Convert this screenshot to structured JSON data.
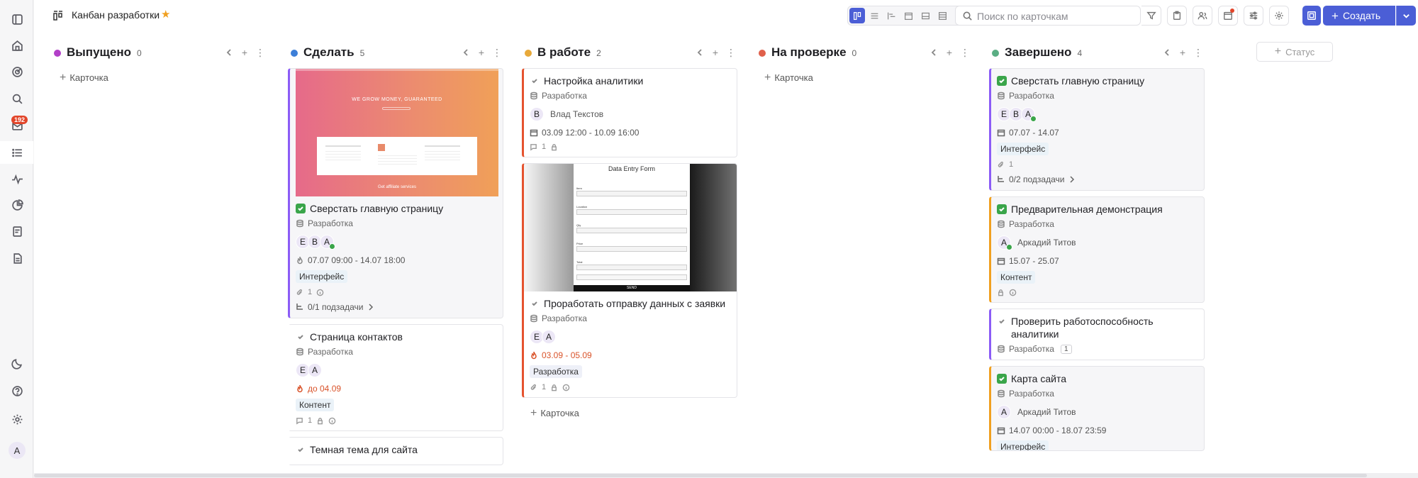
{
  "header": {
    "title": "Канбан разработки",
    "search_placeholder": "Поиск по карточкам",
    "create_label": "Создать"
  },
  "rail": {
    "inbox_badge": "192",
    "avatar": "А"
  },
  "colors": {
    "accent": "#4b5ed6",
    "done_check": "#3aa54a",
    "overdue": "#d9532a"
  },
  "columns": [
    {
      "title": "Выпущено",
      "count": "0",
      "color": "#b23fc8",
      "add_label": "Карточка"
    },
    {
      "title": "Сделать",
      "count": "5",
      "color": "#3d7fd8",
      "add_label": "Карточка"
    },
    {
      "title": "В работе",
      "count": "2",
      "color": "#e8a93a",
      "add_label": "Карточка"
    },
    {
      "title": "На проверке",
      "count": "0",
      "color": "#e0604b",
      "add_label": "Карточка"
    },
    {
      "title": "Завершено",
      "count": "4",
      "color": "#5aae84",
      "add_label": "Карточка"
    }
  ],
  "status_add_label": "Статус",
  "cards": {
    "todo1": {
      "title": "Сверстать главную страницу",
      "project": "Разработка",
      "avatars": [
        "Е",
        "В",
        "А"
      ],
      "date": "07.07 09:00 - 14.07 18:00",
      "tag": "Интерфейс",
      "attach": "1",
      "subtasks": "0/1 подзадачи",
      "image": {
        "headline": "WE GROW MONEY, GUARANTEED",
        "footer": "Get affiliate services"
      }
    },
    "todo2": {
      "title": "Страница контактов",
      "project": "Разработка",
      "avatars": [
        "Е",
        "А"
      ],
      "date": "до 04.09",
      "tag": "Контент",
      "comments": "1"
    },
    "todo3": {
      "title": "Темная тема для сайта"
    },
    "work1": {
      "title": "Настройка аналитики",
      "project": "Разработка",
      "avatar": "В",
      "person": "Влад Текстов",
      "date": "03.09 12:00 - 10.09 16:00",
      "comments": "1"
    },
    "work2": {
      "title": "Проработать отправку данных с заявки",
      "project": "Разработка",
      "avatars": [
        "Е",
        "А"
      ],
      "date": "03.09 - 05.09",
      "tag": "Разработка",
      "attach": "1",
      "image": {
        "form_title": "Data Entry Form",
        "fields": [
          "Item",
          "Location",
          "Qty",
          "Price",
          "Total"
        ],
        "button": "SEND"
      }
    },
    "done1": {
      "title": "Сверстать главную страницу",
      "project": "Разработка",
      "avatars": [
        "Е",
        "В",
        "А"
      ],
      "date": "07.07 - 14.07",
      "tag": "Интерфейс",
      "attach": "1",
      "subtasks": "0/2 подзадачи"
    },
    "done2": {
      "title": "Предварительная демонстрация",
      "project": "Разработка",
      "avatar": "А",
      "person": "Аркадий Титов",
      "date": "15.07 - 25.07",
      "tag": "Контент"
    },
    "done3": {
      "title": "Проверить работоспособность аналитики",
      "project": "Разработка",
      "subcount": "1"
    },
    "done4": {
      "title": "Карта сайта",
      "project": "Разработка",
      "avatar": "А",
      "person": "Аркадий Титов",
      "date": "14.07 00:00 - 18.07 23:59",
      "tag": "Интерфейс"
    }
  }
}
